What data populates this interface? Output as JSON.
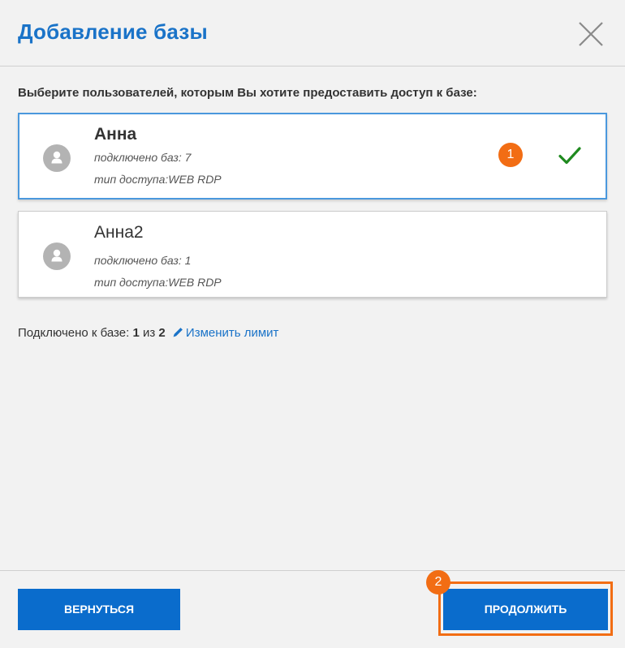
{
  "dialog": {
    "title": "Добавление базы",
    "instruction": "Выберите пользователей, которым Вы хотите предоставить доступ к базе:"
  },
  "users": [
    {
      "name": "Анна",
      "bases_connected": "подключено баз: 7",
      "access_type": "тип доступа:WEB RDP",
      "selected": true
    },
    {
      "name": "Анна2",
      "bases_connected": "подключено баз: 1",
      "access_type": "тип доступа:WEB RDP",
      "selected": false
    }
  ],
  "status": {
    "prefix": "Подключено к базе: ",
    "connected": "1",
    "separator": " из ",
    "limit": "2",
    "change_limit_label": "Изменить лимит"
  },
  "badges": {
    "first": "1",
    "second": "2"
  },
  "buttons": {
    "back_label": "ВЕРНУТЬСЯ",
    "continue_label": "ПРОДОЛЖИТЬ"
  },
  "icons": {
    "close": "close-icon",
    "user": "user-icon",
    "check": "check-icon",
    "pencil": "pencil-icon"
  },
  "colors": {
    "accent": "#1a73c8",
    "button": "#0a6ccc",
    "highlight": "#f26d14",
    "check": "#1f8a1f"
  }
}
